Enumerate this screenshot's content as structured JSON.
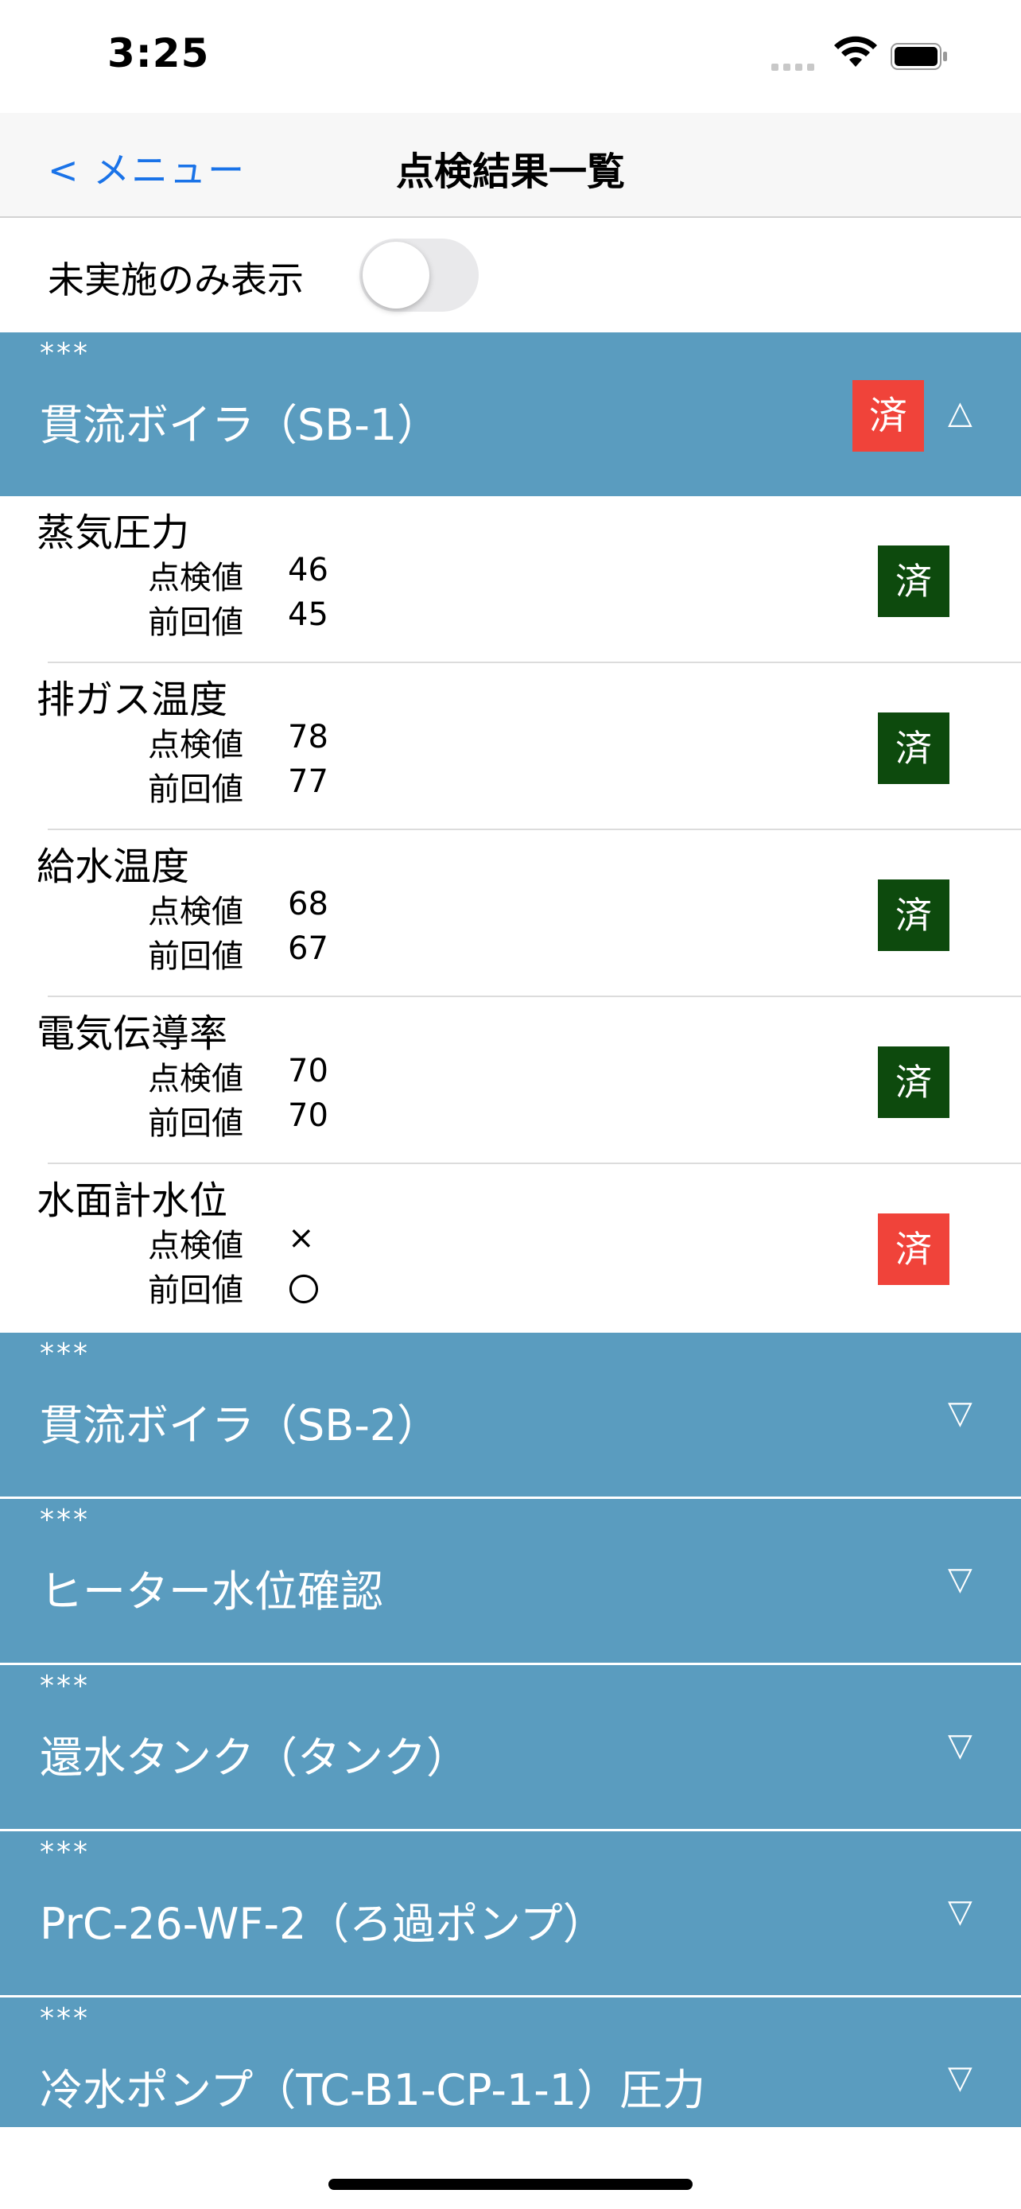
{
  "status_bar": {
    "time": "3:25"
  },
  "nav": {
    "back_label": "< メニュー",
    "title": "点検結果一覧"
  },
  "filter": {
    "label": "未実施のみ表示",
    "enabled": false
  },
  "groups": [
    {
      "sub": "***",
      "title": "貫流ボイラ（SB-1）",
      "badge": "済",
      "chevron": "△",
      "expanded": true,
      "items": [
        {
          "name": "蒸気圧力",
          "check_label": "点検値",
          "check_value": "46",
          "prev_label": "前回値",
          "prev_value": "45",
          "status": "済",
          "status_color": "#0d4a0d"
        },
        {
          "name": "排ガス温度",
          "check_label": "点検値",
          "check_value": "78",
          "prev_label": "前回値",
          "prev_value": "77",
          "status": "済",
          "status_color": "#0d4a0d"
        },
        {
          "name": "給水温度",
          "check_label": "点検値",
          "check_value": "68",
          "prev_label": "前回値",
          "prev_value": "67",
          "status": "済",
          "status_color": "#0d4a0d"
        },
        {
          "name": "電気伝導率",
          "check_label": "点検値",
          "check_value": "70",
          "prev_label": "前回値",
          "prev_value": "70",
          "status": "済",
          "status_color": "#0d4a0d"
        },
        {
          "name": "水面計水位",
          "check_label": "点検値",
          "check_value": "×",
          "prev_label": "前回値",
          "prev_value": "〇",
          "status": "済",
          "status_color": "#f0433a"
        }
      ]
    },
    {
      "sub": "***",
      "title": "貫流ボイラ（SB-2）",
      "chevron": "▽",
      "expanded": false
    },
    {
      "sub": "***",
      "title": "ヒーター水位確認",
      "chevron": "▽",
      "expanded": false
    },
    {
      "sub": "***",
      "title": "還水タンク（タンク）",
      "chevron": "▽",
      "expanded": false
    },
    {
      "sub": "***",
      "title": "PrC-26-WF-2（ろ過ポンプ）",
      "chevron": "▽",
      "expanded": false
    },
    {
      "sub": "***",
      "title": "冷水ポンプ（TC-B1-CP-1-1）圧力",
      "chevron": "▽",
      "expanded": false
    }
  ],
  "colors": {
    "header_bg": "#5a9cbf",
    "badge_red": "#f0433a",
    "badge_green": "#0d4a0d",
    "link_blue": "#1a73e8"
  }
}
